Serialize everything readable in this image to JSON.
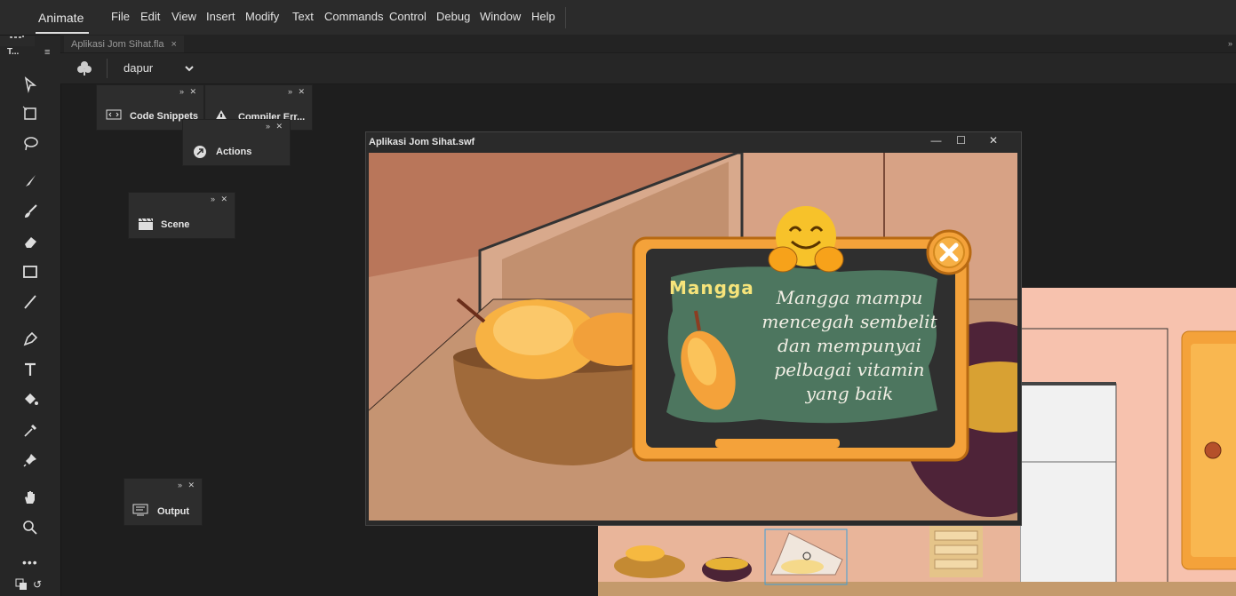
{
  "app": {
    "name": "Animate"
  },
  "menu": [
    "File",
    "Edit",
    "View",
    "Insert",
    "Modify",
    "Text",
    "Commands",
    "Control",
    "Debug",
    "Window",
    "Help"
  ],
  "tools_panel": {
    "title": "T..."
  },
  "document_tab": {
    "label": "Aplikasi Jom Sihat.fla",
    "close": "×"
  },
  "scene": {
    "selected": "dapur"
  },
  "panels": {
    "code_snippets": "Code Snippets",
    "compiler_errors": "Compiler Err...",
    "actions": "Actions",
    "scene": "Scene",
    "output": "Output"
  },
  "swf_window": {
    "title": "Aplikasi Jom Sihat.swf",
    "minimize": "—",
    "maximize": "☐",
    "close": "✕"
  },
  "popup": {
    "fruit_name": "Mangga",
    "message": [
      "Mangga mampu",
      "mencegah sembelit",
      "dan mempunyai",
      "pelbagai vitamin",
      "yang baik"
    ]
  },
  "colors": {
    "accent_orange": "#f4a23a",
    "chalkboard_green": "#4f7a62",
    "stage_peach": "#f7c2ae"
  }
}
